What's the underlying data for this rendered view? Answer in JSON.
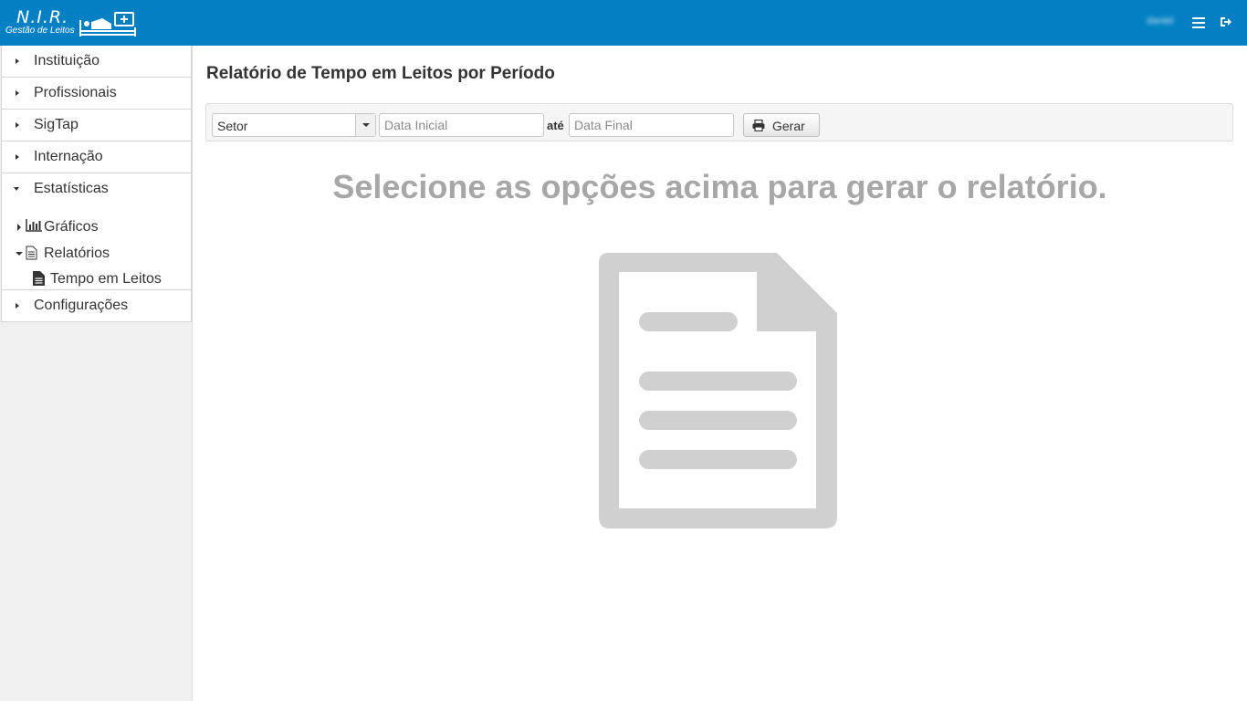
{
  "header": {
    "logo_title": "N.I.R.",
    "logo_subtitle": "Gestão de Leitos",
    "user_name": "daniel",
    "menu_icon": "hamburger-icon",
    "logout_icon": "sign-out-icon",
    "background_color": "#0380c4"
  },
  "sidebar": {
    "items": [
      {
        "label": "Instituição",
        "icon": "caret-right-icon"
      },
      {
        "label": "Profissionais",
        "icon": "caret-right-icon"
      },
      {
        "label": "SigTap",
        "icon": "caret-right-icon"
      },
      {
        "label": "Internação",
        "icon": "caret-right-icon"
      },
      {
        "label": "Estatísticas",
        "icon": "caret-down-icon",
        "children": [
          {
            "label": "Gráficos",
            "icon": "bar-chart-icon"
          },
          {
            "label": "Relatórios",
            "icon": "file-text-icon",
            "children": [
              {
                "label": "Tempo em Leitos",
                "icon": "file-icon"
              }
            ]
          }
        ]
      },
      {
        "label": "Configurações",
        "icon": "caret-right-icon"
      }
    ]
  },
  "main": {
    "title": "Relatório de Tempo em Leitos por Período",
    "filters": {
      "setor_value": "Setor",
      "data_inicial_placeholder": "Data Inicial",
      "ate_label": "até",
      "data_final_placeholder": "Data Final",
      "gerar_label": "Gerar",
      "gerar_icon": "print-icon"
    },
    "empty_message": "Selecione as opções acima para gerar o relatório.",
    "empty_icon": "document-icon"
  }
}
